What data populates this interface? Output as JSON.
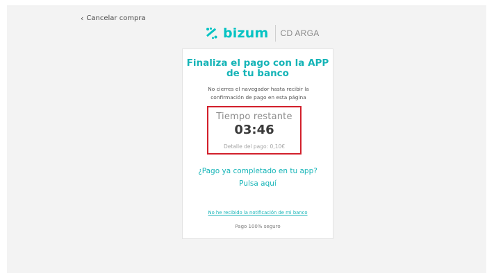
{
  "nav": {
    "cancel_label": "Cancelar compra"
  },
  "brand": {
    "logo_icon": "bizum-logo-icon",
    "name": "bizum",
    "merchant": "CD ARGA",
    "color": "#05c3c3"
  },
  "card": {
    "title_line1": "Finaliza el pago con la APP",
    "title_line2": "de tu banco",
    "note_line1": "No cierres el navegador hasta recibir la",
    "note_line2": "confirmación de pago en esta página",
    "timer": {
      "label": "Tiempo restante",
      "value": "03:46",
      "detail": "Detalle del pago: 0,10€"
    },
    "completed_question": "¿Pago ya completado en tu app?",
    "completed_link": "Pulsa aquí",
    "no_notification_link": "No he recibido la notificación de mi banco",
    "secure_text": "Pago 100% seguro"
  },
  "colors": {
    "accent": "#15b4b7",
    "highlight_border": "#d21f2b",
    "background": "#f3f3f3"
  }
}
